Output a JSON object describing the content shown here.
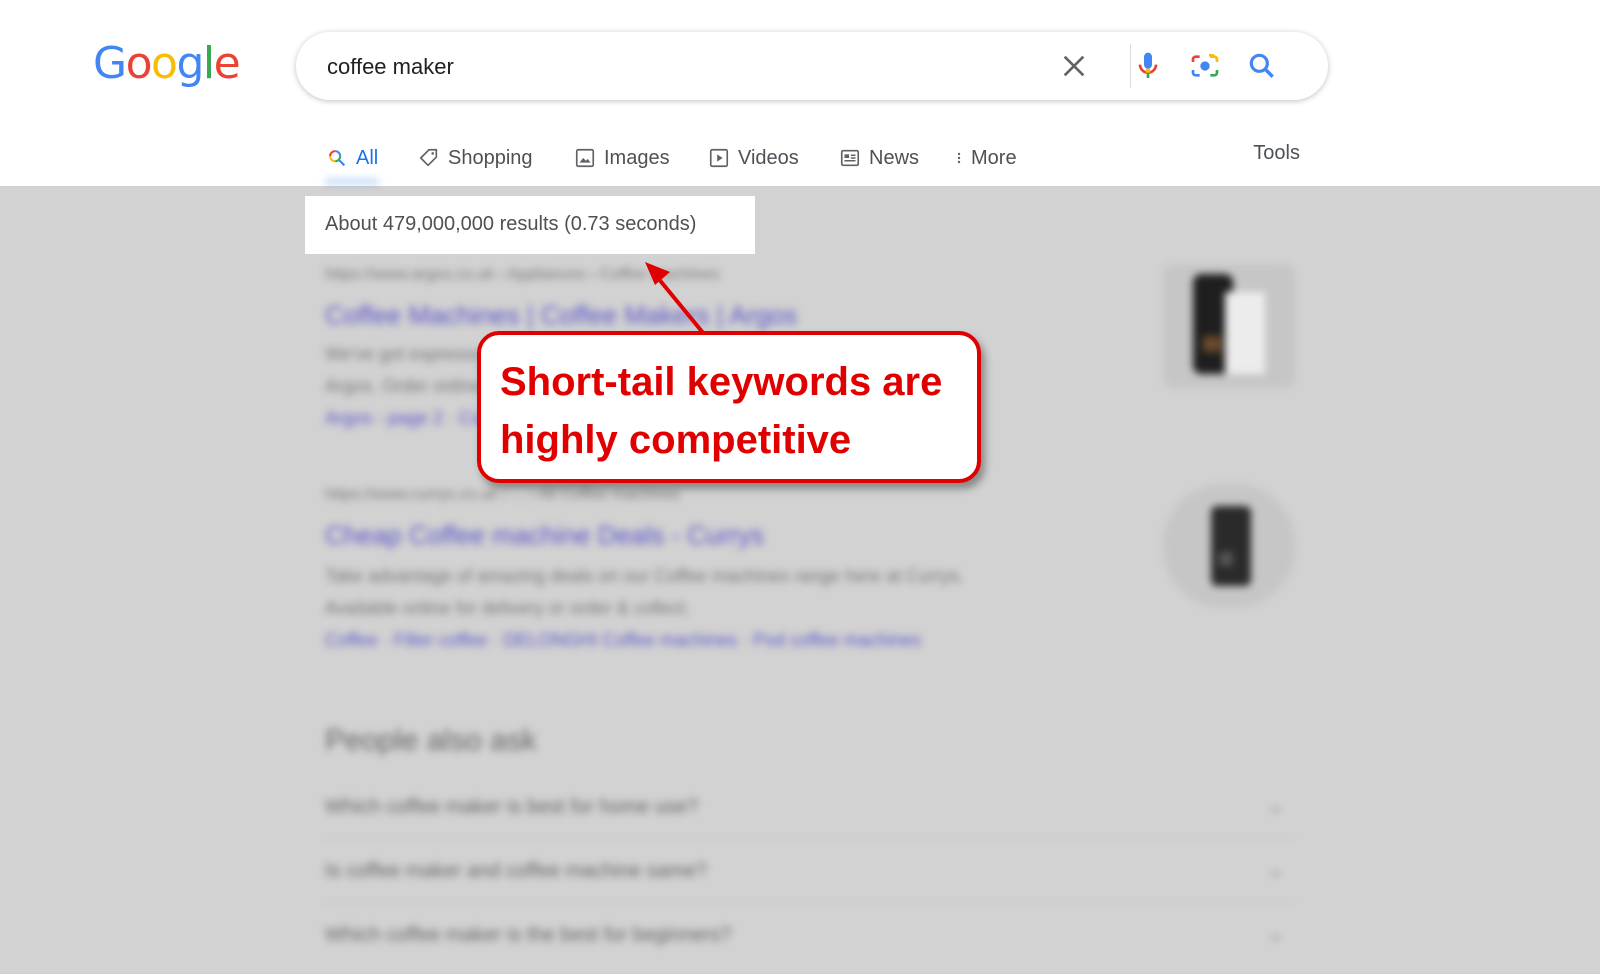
{
  "logo": {
    "letters": [
      "G",
      "o",
      "o",
      "g",
      "l",
      "e"
    ],
    "colors": [
      "#4285F4",
      "#EA4335",
      "#FBBC05",
      "#4285F4",
      "#34A853",
      "#EA4335"
    ]
  },
  "search": {
    "query": "coffee maker"
  },
  "tabs": [
    {
      "label": "All",
      "icon": "search-icon",
      "active": true
    },
    {
      "label": "Shopping",
      "icon": "tag-icon"
    },
    {
      "label": "Images",
      "icon": "image-icon"
    },
    {
      "label": "Videos",
      "icon": "play-icon"
    },
    {
      "label": "News",
      "icon": "newspaper-icon"
    },
    {
      "label": "More",
      "icon": "more-vert-icon"
    }
  ],
  "tools_label": "Tools",
  "result_stats": "About 479,000,000 results (0.73 seconds)",
  "callout": {
    "text": "Short-tail keywords are highly competitive",
    "color": "#e00000"
  },
  "results": [
    {
      "url": "https://www.argos.co.uk › Appliances › Coffee machines",
      "title": "Coffee Machines | Coffee Makers | Argos",
      "snippet_1": "We've got espresso machines, filter coffee makers and pod coffee makers at",
      "snippet_2": "Argos. Order online or reserve in store",
      "links": "Argos - page 2 · Coffee pod machines · Filter coffee · Bean to cup · Brewing tips"
    },
    {
      "url": "https://www.currys.co.uk › ... › All Coffee machines",
      "title": "Cheap Coffee machine Deals - Currys",
      "snippet_1": "Take advantage of amazing deals on our Coffee machines range here at Currys.",
      "snippet_2": "Available online for delivery or order & collect.",
      "links": "Coffee · Filter coffee · DELONGHI Coffee machines · Pod coffee machines"
    }
  ],
  "paa": {
    "heading": "People also ask",
    "questions": [
      "Which coffee maker is best for home use?",
      "Is coffee maker and coffee machine same?",
      "Which coffee maker is the best for beginners?"
    ]
  }
}
